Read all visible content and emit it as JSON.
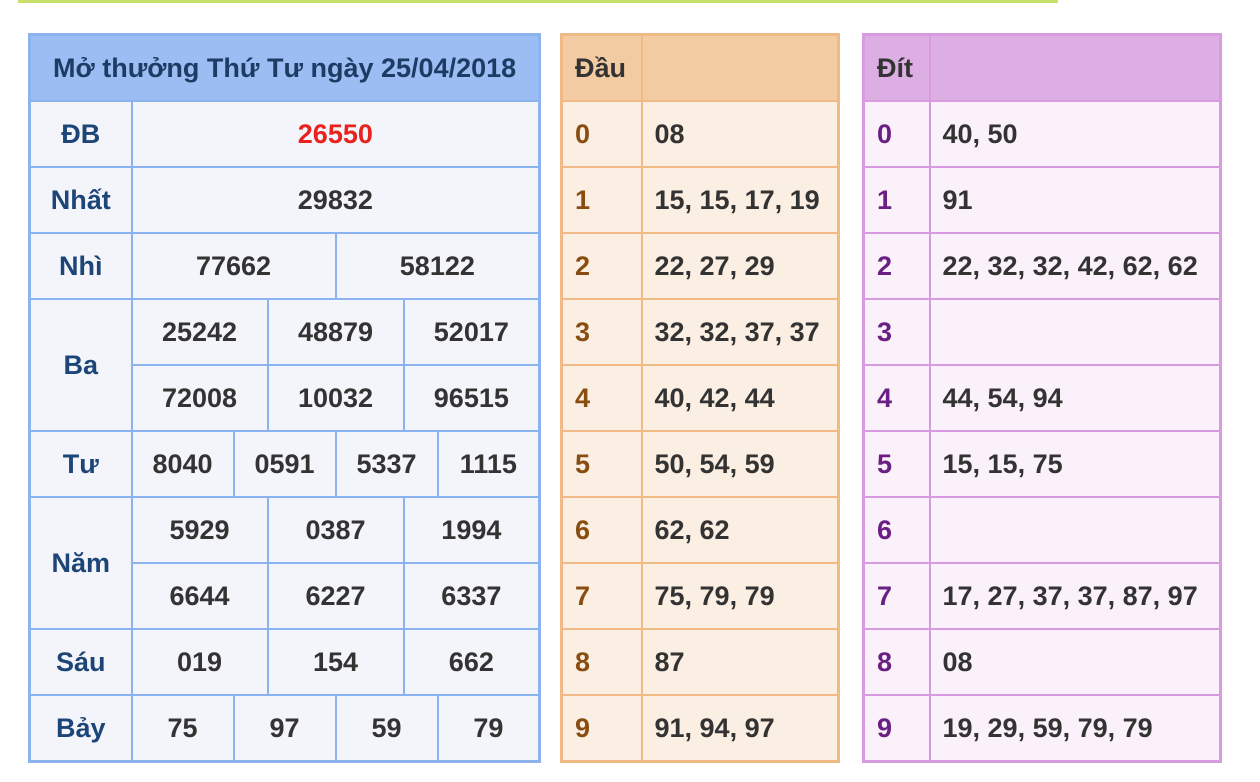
{
  "results": {
    "title": "Mở thưởng Thứ Tư ngày 25/04/2018",
    "prizes": [
      {
        "name": "ĐB",
        "rows": [
          [
            "26550"
          ]
        ]
      },
      {
        "name": "Nhất",
        "rows": [
          [
            "29832"
          ]
        ]
      },
      {
        "name": "Nhì",
        "rows": [
          [
            "77662",
            "58122"
          ]
        ]
      },
      {
        "name": "Ba",
        "rows": [
          [
            "25242",
            "48879",
            "52017"
          ],
          [
            "72008",
            "10032",
            "96515"
          ]
        ]
      },
      {
        "name": "Tư",
        "rows": [
          [
            "8040",
            "0591",
            "5337",
            "1115"
          ]
        ]
      },
      {
        "name": "Năm",
        "rows": [
          [
            "5929",
            "0387",
            "1994"
          ],
          [
            "6644",
            "6227",
            "6337"
          ]
        ]
      },
      {
        "name": "Sáu",
        "rows": [
          [
            "019",
            "154",
            "662"
          ]
        ]
      },
      {
        "name": "Bảy",
        "rows": [
          [
            "75",
            "97",
            "59",
            "79"
          ]
        ]
      }
    ]
  },
  "dau": {
    "header": "Đầu",
    "rows": [
      {
        "idx": "0",
        "value": "08"
      },
      {
        "idx": "1",
        "value": "15, 15, 17, 19"
      },
      {
        "idx": "2",
        "value": "22, 27, 29"
      },
      {
        "idx": "3",
        "value": "32, 32, 37, 37"
      },
      {
        "idx": "4",
        "value": "40, 42, 44"
      },
      {
        "idx": "5",
        "value": "50, 54, 59"
      },
      {
        "idx": "6",
        "value": "62, 62"
      },
      {
        "idx": "7",
        "value": "75, 79, 79"
      },
      {
        "idx": "8",
        "value": "87"
      },
      {
        "idx": "9",
        "value": "91, 94, 97"
      }
    ]
  },
  "dit": {
    "header": "Đít",
    "rows": [
      {
        "idx": "0",
        "value": "40, 50"
      },
      {
        "idx": "1",
        "value": "91"
      },
      {
        "idx": "2",
        "value": "22, 32, 32, 42, 62, 62"
      },
      {
        "idx": "3",
        "value": ""
      },
      {
        "idx": "4",
        "value": "44, 54, 94"
      },
      {
        "idx": "5",
        "value": "15, 15, 75"
      },
      {
        "idx": "6",
        "value": ""
      },
      {
        "idx": "7",
        "value": "17, 27, 37, 37, 87, 97"
      },
      {
        "idx": "8",
        "value": "08"
      },
      {
        "idx": "9",
        "value": "19, 29, 59, 79, 79"
      }
    ]
  },
  "colors": {
    "results_border": "#8db3ef",
    "results_header": "#9bbdf4",
    "special_prize": "#e8221d",
    "dau_border": "#efba86",
    "dit_border": "#d89be0"
  }
}
